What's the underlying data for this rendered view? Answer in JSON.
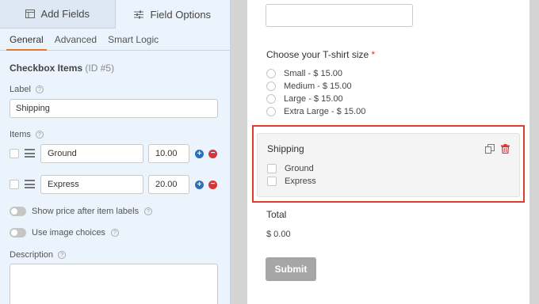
{
  "tabs": {
    "add_fields": "Add Fields",
    "field_options": "Field Options"
  },
  "subtabs": {
    "general": "General",
    "advanced": "Advanced",
    "smart_logic": "Smart Logic"
  },
  "field": {
    "type_label": "Checkbox Items",
    "id_label": "(ID #5)",
    "label_caption": "Label",
    "label_value": "Shipping",
    "items_caption": "Items",
    "items": [
      {
        "label": "Ground",
        "price": "10.00"
      },
      {
        "label": "Express",
        "price": "20.00"
      }
    ],
    "show_price_label": "Show price after item labels",
    "use_image_label": "Use image choices",
    "description_caption": "Description"
  },
  "preview": {
    "tshirt_label": "Choose your T-shirt size",
    "required_mark": "*",
    "sizes": [
      "Small - $ 15.00",
      "Medium - $ 15.00",
      "Large - $ 15.00",
      "Extra Large - $ 15.00"
    ],
    "shipping_title": "Shipping",
    "shipping_options": [
      "Ground",
      "Express"
    ],
    "total_label": "Total",
    "total_value": "$ 0.00",
    "submit_label": "Submit"
  },
  "colors": {
    "accent": "#e27730",
    "highlight": "#e03c31",
    "add": "#2d6fb7",
    "remove": "#d63638"
  }
}
